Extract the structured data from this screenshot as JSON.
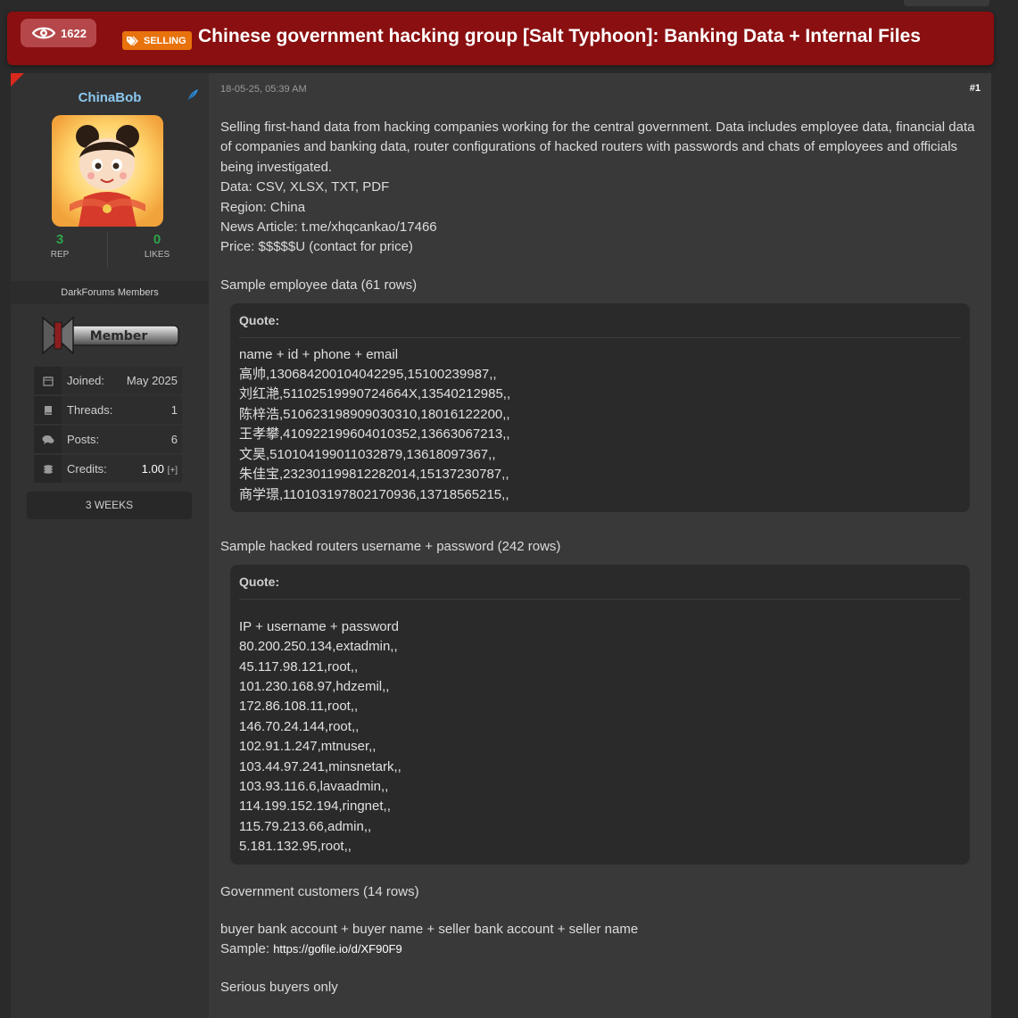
{
  "header": {
    "views": "1622",
    "prefix_label": "SELLING",
    "title": "Chinese government hacking group [Salt Typhoon]: Banking Data + Internal Files"
  },
  "profile": {
    "username": "ChinaBob",
    "reputation": {
      "value": "3",
      "label": "REP"
    },
    "likes": {
      "value": "0",
      "label": "LIKES"
    },
    "group": "DarkForums Members",
    "rank_badge": "Member",
    "info": [
      {
        "icon": "calendar-icon",
        "label": "Joined:",
        "value": "May 2025"
      },
      {
        "icon": "book-icon",
        "label": "Threads:",
        "value": "1"
      },
      {
        "icon": "comments-icon",
        "label": "Posts:",
        "value": "6"
      },
      {
        "icon": "coins-icon",
        "label": "Credits:",
        "value": "1.00",
        "extra": "[+]"
      }
    ],
    "duration": "3 WEEKS"
  },
  "post": {
    "date": "18-05-25, 05:39 AM",
    "number": "#1",
    "intro": "Selling first-hand data from hacking companies working for the central government.  Data includes employee data, financial data of companies and banking data, router configurations of hacked routers with passwords and chats of employees and officials being investigated.",
    "data_line": "Data: CSV, XLSX, TXT, PDF",
    "region_line": "Region: China",
    "news_line": "News Article: t.me/xhqcankao/17466",
    "price_line": "Price: $$$$$U (contact for price)",
    "employee_heading": "Sample employee data (61 rows)",
    "quote_label": "Quote:",
    "employee_quote": [
      "name + id + phone + email",
      "高帅,130684200104042295,15100239987,,",
      "刘红滟,51102519990724664X,13540212985,,",
      "陈梓浩,510623198909030310,18016122200,,",
      "王孝攀,410922199604010352,13663067213,,",
      "文昊,510104199011032879,13618097367,,",
      "朱佳宝,232301199812282014,15137230787,,",
      "商学璟,110103197802170936,13718565215,,"
    ],
    "router_heading": "Sample hacked routers username + password (242 rows)",
    "router_quote": [
      "IP + username + password",
      "80.200.250.134,extadmin,,",
      "45.117.98.121,root,,",
      "101.230.168.97,hdzemil,,",
      "172.86.108.11,root,,",
      "146.70.24.144,root,,",
      "102.91.1.247,mtnuser,,",
      "103.44.97.241,minsnetark,,",
      "103.93.116.6,lavaadmin,,",
      "114.199.152.194,ringnet,,",
      "115.79.213.66,admin,,",
      "5.181.132.95,root,,"
    ],
    "gov_heading": "Government customers (14 rows)",
    "gov_fields": "buyer bank account + buyer name + seller bank account + seller name",
    "sample_label": "Sample:",
    "sample_link": "https://gofile.io/d/XF90F9",
    "closing": "Serious buyers only"
  }
}
